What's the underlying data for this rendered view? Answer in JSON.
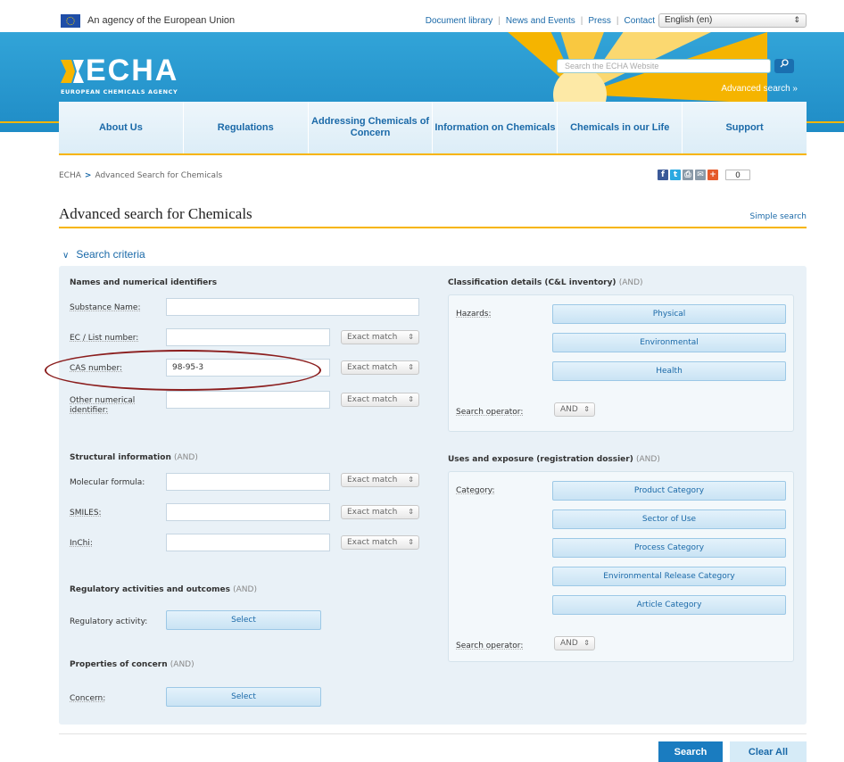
{
  "topbar": {
    "agency_text": "An agency of the European Union",
    "links": [
      "Document library",
      "News and Events",
      "Press",
      "Contact"
    ],
    "language": "English (en)"
  },
  "header": {
    "logo_text": "ECHA",
    "logo_subtitle": "EUROPEAN CHEMICALS AGENCY",
    "search_placeholder": "Search the ECHA Website",
    "advanced_search": "Advanced search »"
  },
  "nav": [
    "About Us",
    "Regulations",
    "Addressing Chemicals of Concern",
    "Information on Chemicals",
    "Chemicals in our Life",
    "Support"
  ],
  "breadcrumb": {
    "home": "ECHA",
    "sep": ">",
    "current": "Advanced Search for Chemicals"
  },
  "share": {
    "count": "0"
  },
  "page": {
    "title": "Advanced search for Chemicals",
    "simple_search": "Simple search",
    "criteria_toggle": "Search criteria"
  },
  "left": {
    "names_title": "Names and numerical identifiers",
    "substance_name_label": "Substance Name:",
    "substance_name_value": "",
    "ec_label": "EC / List number:",
    "ec_value": "",
    "cas_label": "CAS number:",
    "cas_value": "98-95-3",
    "other_label": "Other numerical identifier:",
    "other_value": "",
    "exact_match": "Exact match",
    "structural_title": "Structural information",
    "structural_op": "(AND)",
    "formula_label": "Molecular formula:",
    "smiles_label": "SMILES:",
    "inchi_label": "InChi:",
    "regulatory_title": "Regulatory activities and outcomes",
    "regulatory_op": "(AND)",
    "regulatory_label": "Regulatory activity:",
    "concern_title": "Properties of concern",
    "concern_op": "(AND)",
    "concern_label": "Concern:",
    "select": "Select"
  },
  "right": {
    "classification_title": "Classification details (C&L inventory)",
    "classification_op": "(AND)",
    "hazards_label": "Hazards:",
    "hazard_buttons": [
      "Physical",
      "Environmental",
      "Health"
    ],
    "search_operator_label": "Search operator:",
    "operator_value": "AND",
    "uses_title": "Uses and exposure (registration dossier)",
    "uses_op": "(AND)",
    "category_label": "Category:",
    "category_buttons": [
      "Product Category",
      "Sector of Use",
      "Process Category",
      "Environmental Release Category",
      "Article Category"
    ]
  },
  "actions": {
    "search": "Search",
    "clear": "Clear All"
  }
}
